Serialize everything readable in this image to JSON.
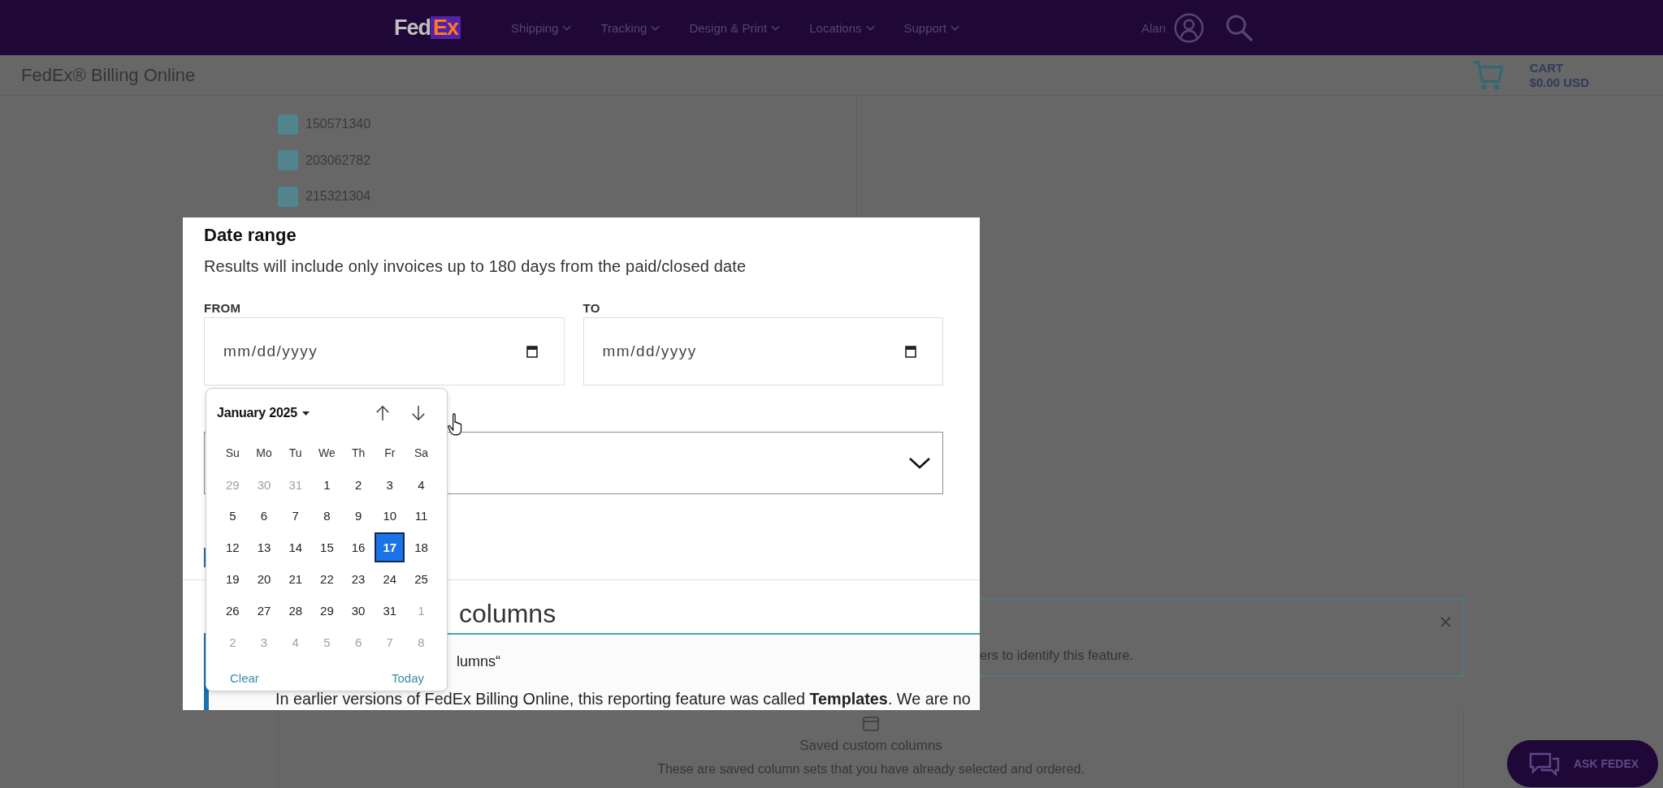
{
  "header": {
    "logo": {
      "part_1": "Fed",
      "part_2": "Ex"
    },
    "nav": [
      {
        "label": "Shipping"
      },
      {
        "label": "Tracking"
      },
      {
        "label": "Design & Print"
      },
      {
        "label": "Locations"
      },
      {
        "label": "Support"
      }
    ],
    "user_name": "Alan"
  },
  "page_header": {
    "title": "FedEx® Billing Online",
    "cart": {
      "label": "CART",
      "total": "$0.00 USD"
    }
  },
  "account_list": [
    {
      "number": "150571340",
      "checked": true
    },
    {
      "number": "203062782",
      "checked": true
    },
    {
      "number": "215321304",
      "checked": true
    }
  ],
  "notice": {
    "text": "ers to identify this feature."
  },
  "saved_columns_card": {
    "title": "Saved custom columns",
    "description": "These are saved column sets that you have already selected and ordered."
  },
  "ask_button": {
    "label": "ASK FEDEX"
  },
  "dialog": {
    "title": "Date range",
    "description": "Results will include only invoices up to 180 days from the paid/closed date",
    "from": {
      "label": "FROM",
      "placeholder": "mm/dd/yyyy"
    },
    "to": {
      "label": "TO",
      "placeholder": "mm/dd/yyyy"
    },
    "section_heading": "columns",
    "panel": {
      "title": "lumns“",
      "text": "In earlier versions of FedEx Billing Online, this reporting feature was called **Templates**. We are no"
    }
  },
  "date_picker": {
    "month": "January 2025",
    "weekdays": [
      "Su",
      "Mo",
      "Tu",
      "We",
      "Th",
      "Fr",
      "Sa"
    ],
    "weeks": [
      [
        {
          "day": "29",
          "outside": true,
          "selected": false
        },
        {
          "day": "30",
          "outside": true,
          "selected": false
        },
        {
          "day": "31",
          "outside": true,
          "selected": false
        },
        {
          "day": "1",
          "outside": false,
          "selected": false
        },
        {
          "day": "2",
          "outside": false,
          "selected": false
        },
        {
          "day": "3",
          "outside": false,
          "selected": false
        },
        {
          "day": "4",
          "outside": false,
          "selected": false
        }
      ],
      [
        {
          "day": "5",
          "outside": false,
          "selected": false
        },
        {
          "day": "6",
          "outside": false,
          "selected": false
        },
        {
          "day": "7",
          "outside": false,
          "selected": false
        },
        {
          "day": "8",
          "outside": false,
          "selected": false
        },
        {
          "day": "9",
          "outside": false,
          "selected": false
        },
        {
          "day": "10",
          "outside": false,
          "selected": false
        },
        {
          "day": "11",
          "outside": false,
          "selected": false
        }
      ],
      [
        {
          "day": "12",
          "outside": false,
          "selected": false
        },
        {
          "day": "13",
          "outside": false,
          "selected": false
        },
        {
          "day": "14",
          "outside": false,
          "selected": false
        },
        {
          "day": "15",
          "outside": false,
          "selected": false
        },
        {
          "day": "16",
          "outside": false,
          "selected": false
        },
        {
          "day": "17",
          "outside": false,
          "selected": true
        },
        {
          "day": "18",
          "outside": false,
          "selected": false
        }
      ],
      [
        {
          "day": "19",
          "outside": false,
          "selected": false
        },
        {
          "day": "20",
          "outside": false,
          "selected": false
        },
        {
          "day": "21",
          "outside": false,
          "selected": false
        },
        {
          "day": "22",
          "outside": false,
          "selected": false
        },
        {
          "day": "23",
          "outside": false,
          "selected": false
        },
        {
          "day": "24",
          "outside": false,
          "selected": false
        },
        {
          "day": "25",
          "outside": false,
          "selected": false
        }
      ],
      [
        {
          "day": "26",
          "outside": false,
          "selected": false
        },
        {
          "day": "27",
          "outside": false,
          "selected": false
        },
        {
          "day": "28",
          "outside": false,
          "selected": false
        },
        {
          "day": "29",
          "outside": false,
          "selected": false
        },
        {
          "day": "30",
          "outside": false,
          "selected": false
        },
        {
          "day": "31",
          "outside": false,
          "selected": false
        },
        {
          "day": "1",
          "outside": true,
          "selected": false
        }
      ],
      [
        {
          "day": "2",
          "outside": true,
          "selected": false
        },
        {
          "day": "3",
          "outside": true,
          "selected": false
        },
        {
          "day": "4",
          "outside": true,
          "selected": false
        },
        {
          "day": "5",
          "outside": true,
          "selected": false
        },
        {
          "day": "6",
          "outside": true,
          "selected": false
        },
        {
          "day": "7",
          "outside": true,
          "selected": false
        },
        {
          "day": "8",
          "outside": true,
          "selected": false
        }
      ]
    ],
    "clear": "Clear",
    "today": "Today"
  }
}
